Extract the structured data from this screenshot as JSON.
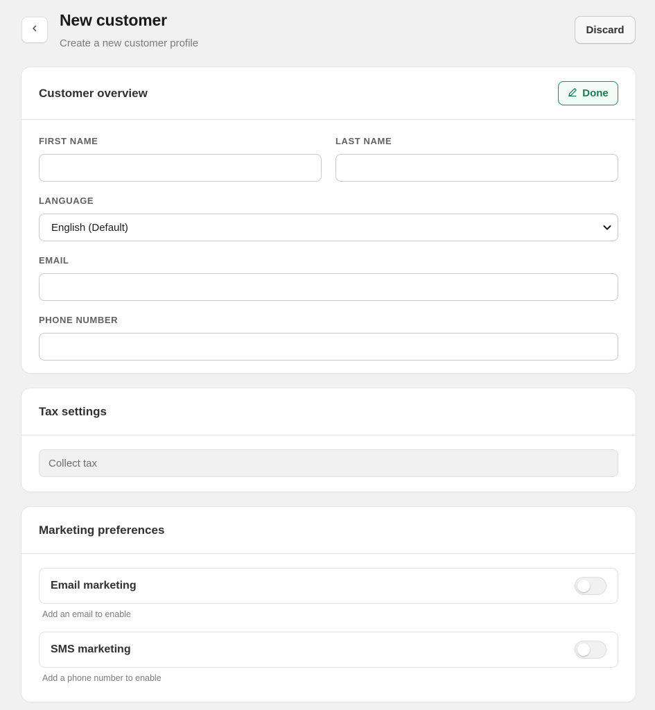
{
  "header": {
    "title": "New customer",
    "subtitle": "Create a new customer profile",
    "discard_label": "Discard",
    "back_icon": "chevron-left-icon"
  },
  "overview": {
    "title": "Customer overview",
    "done_label": "Done",
    "done_icon": "pencil-icon",
    "accent_color": "#1f8a65",
    "first_name": {
      "label": "FIRST NAME",
      "value": ""
    },
    "last_name": {
      "label": "LAST NAME",
      "value": ""
    },
    "language": {
      "label": "LANGUAGE",
      "selected": "English (Default)"
    },
    "email": {
      "label": "EMAIL",
      "value": ""
    },
    "phone": {
      "label": "PHONE NUMBER",
      "value": ""
    }
  },
  "tax": {
    "title": "Tax settings",
    "collect_tax": "Collect tax"
  },
  "marketing": {
    "title": "Marketing preferences",
    "email": {
      "label": "Email marketing",
      "help": "Add an email to enable",
      "enabled": false
    },
    "sms": {
      "label": "SMS marketing",
      "help": "Add a phone number to enable",
      "enabled": false
    }
  }
}
